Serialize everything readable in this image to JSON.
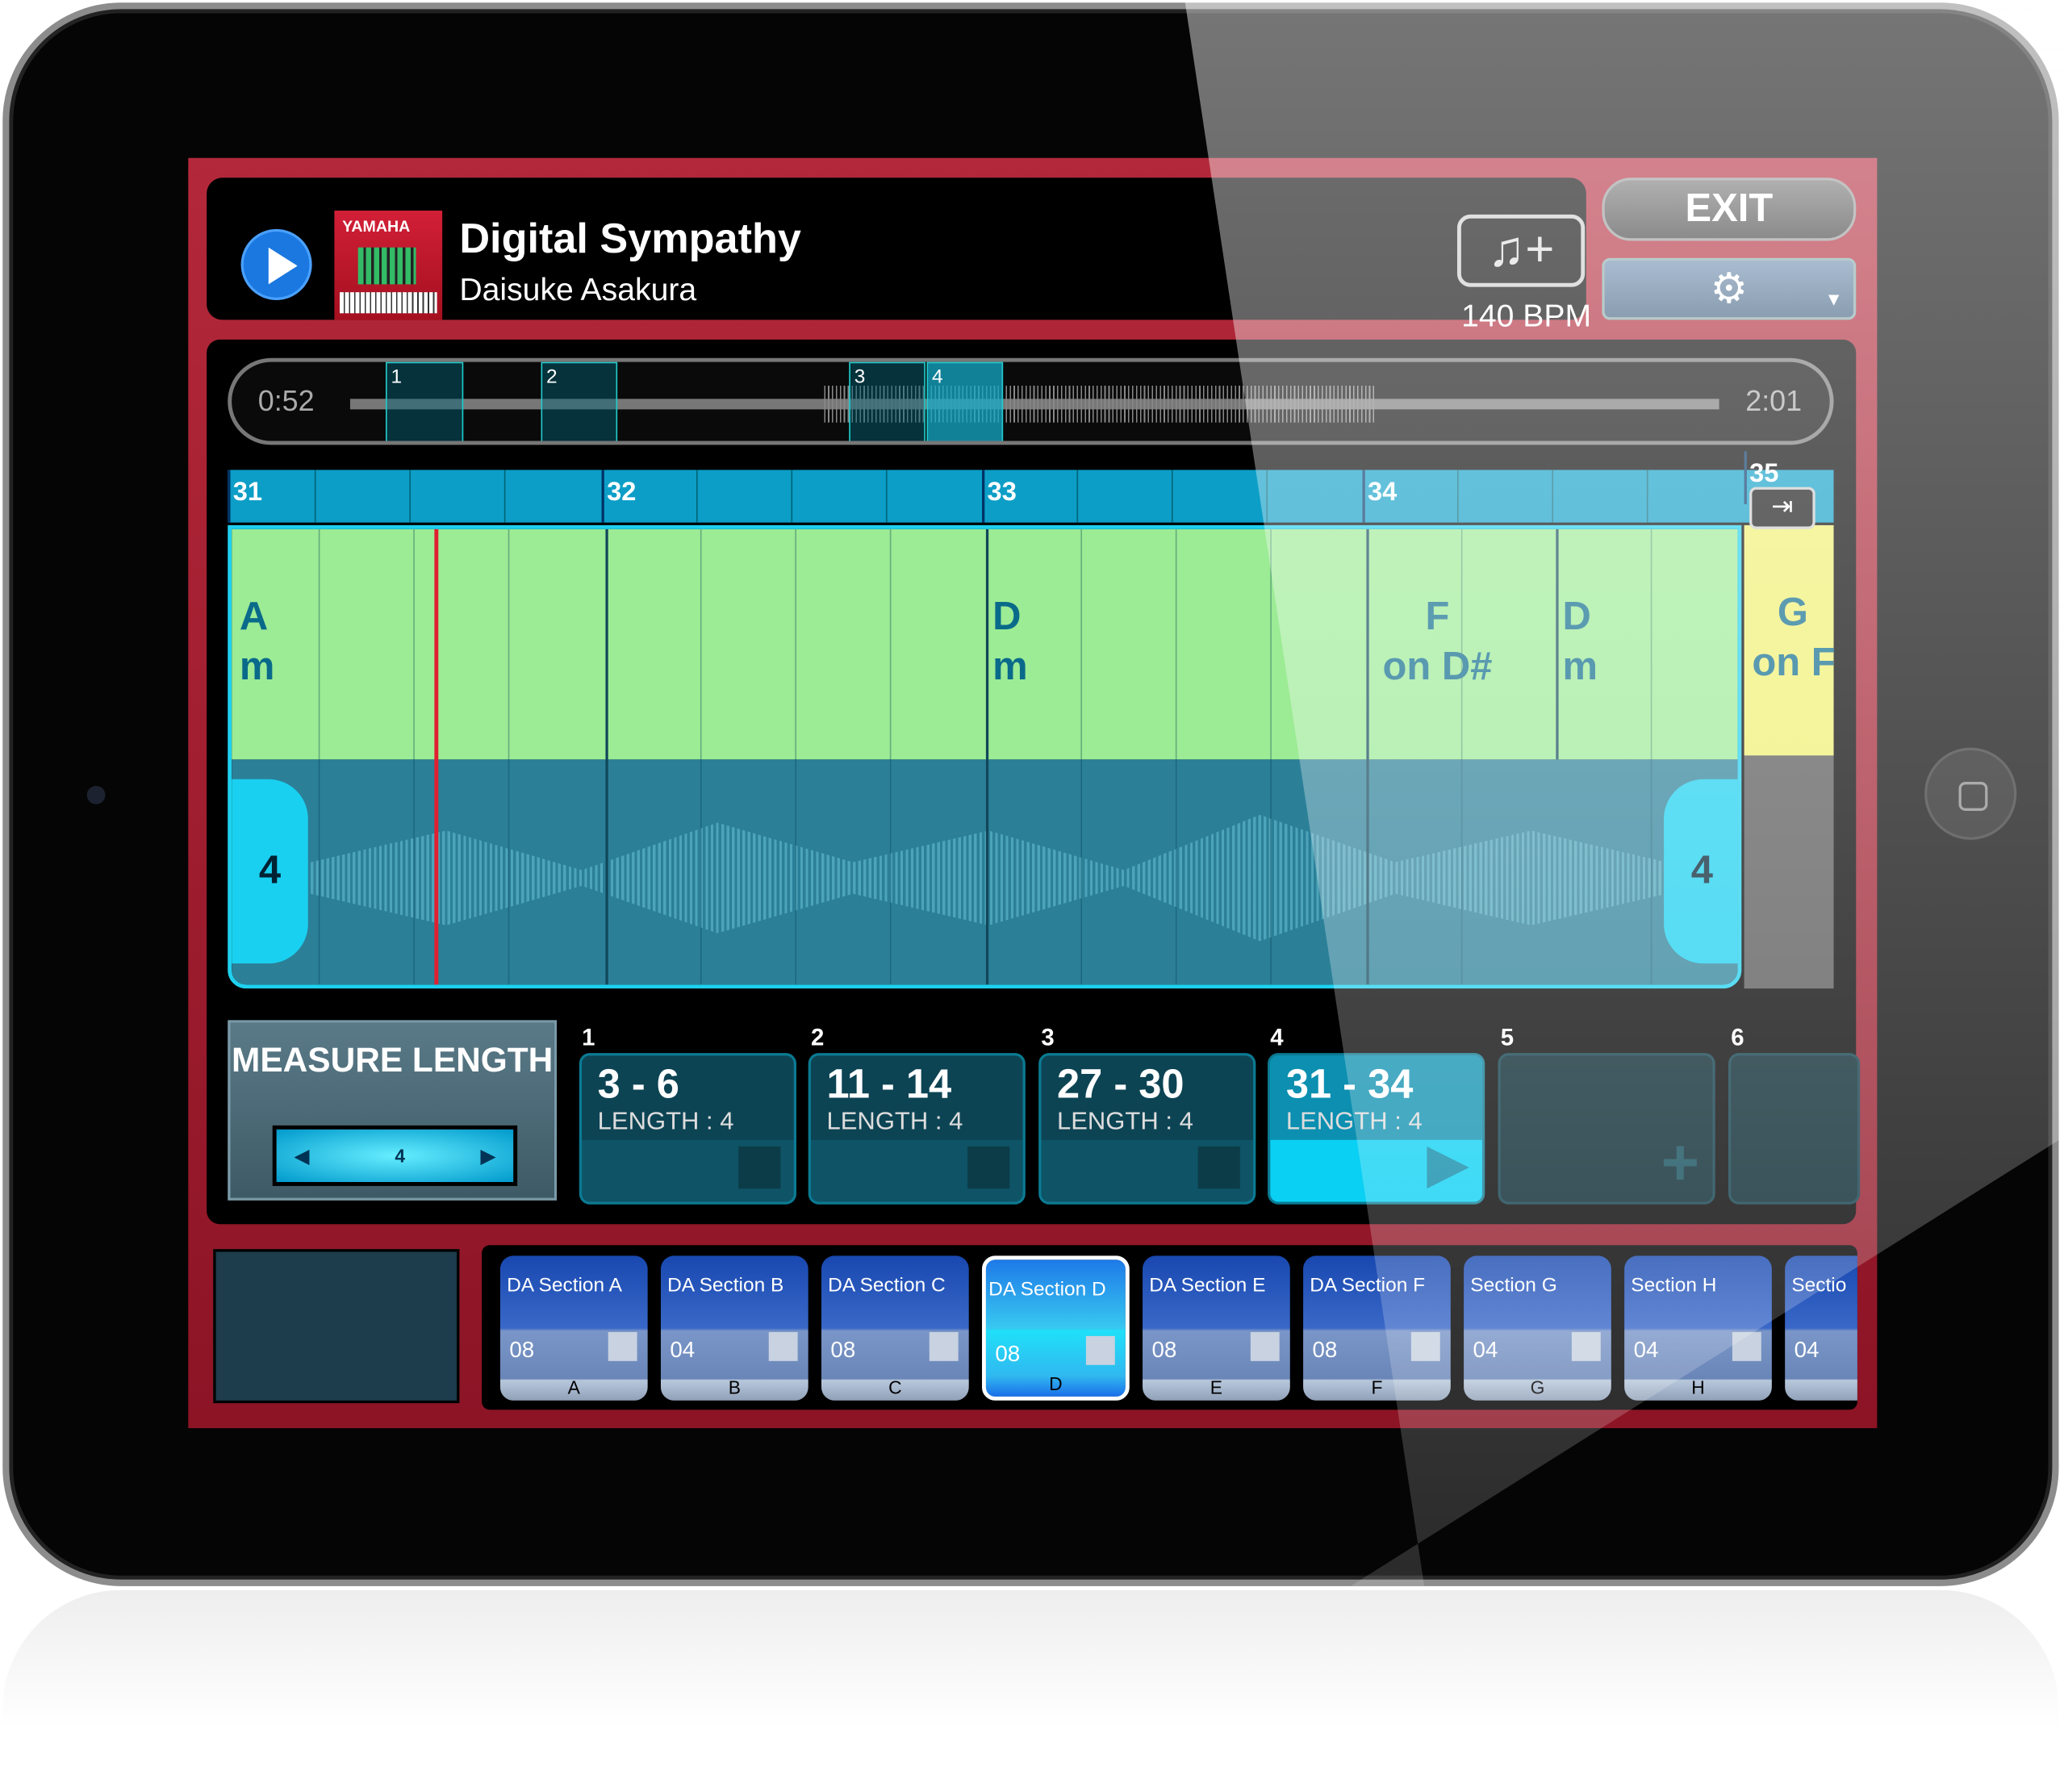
{
  "header": {
    "title": "Digital Sympathy",
    "artist": "Daisuke Asakura",
    "bpm": "140 BPM",
    "album_logo": "YAMAHA",
    "play_icon": "play-icon",
    "bpm_button_icon": "music-note-plus-icon",
    "exit_label": "EXIT",
    "settings_icon": "gear-icon"
  },
  "overview": {
    "start_time": "0:52",
    "end_time": "2:01",
    "sections": [
      "1",
      "2",
      "3",
      "4"
    ],
    "active_section": "4"
  },
  "ruler": {
    "measures": [
      "31",
      "32",
      "33",
      "34",
      "35"
    ]
  },
  "chords": [
    {
      "root": "A",
      "quality": "m"
    },
    {
      "root": "D",
      "quality": "m"
    },
    {
      "root": "F",
      "quality": "on D#"
    },
    {
      "root": "D",
      "quality": "m"
    },
    {
      "root": "G",
      "quality": "on F"
    }
  ],
  "loop_handles": {
    "left": "4",
    "right": "4"
  },
  "measure_length": {
    "label": "MEASURE LENGTH",
    "value": "4"
  },
  "slots": [
    {
      "num": "1",
      "range": "3 - 6",
      "length": "LENGTH : 4"
    },
    {
      "num": "2",
      "range": "11 - 14",
      "length": "LENGTH : 4"
    },
    {
      "num": "3",
      "range": "27 - 30",
      "length": "LENGTH : 4"
    },
    {
      "num": "4",
      "range": "31 - 34",
      "length": "LENGTH : 4",
      "active": true
    },
    {
      "num": "5",
      "empty": true
    },
    {
      "num": "6",
      "empty": true
    }
  ],
  "sections": [
    {
      "name": "DA Section A",
      "count": "08",
      "key": "A"
    },
    {
      "name": "DA Section B",
      "count": "04",
      "key": "B"
    },
    {
      "name": "DA Section C",
      "count": "08",
      "key": "C"
    },
    {
      "name": "DA Section D",
      "count": "08",
      "key": "D",
      "selected": true
    },
    {
      "name": "DA Section E",
      "count": "08",
      "key": "E"
    },
    {
      "name": "DA Section F",
      "count": "08",
      "key": "F"
    },
    {
      "name": "Section G",
      "count": "04",
      "key": "G"
    },
    {
      "name": "Section H",
      "count": "04",
      "key": "H"
    },
    {
      "name": "Sectio",
      "count": "04",
      "key": ""
    }
  ],
  "colors": {
    "frame": "#b3283a",
    "ruler": "#0c9ec7",
    "chord_lane": "#9ceb95",
    "chord_next": "#f0f070",
    "waveform": "#2b8098",
    "playhead": "#e02030",
    "active_slot": "#0ad0f4"
  }
}
